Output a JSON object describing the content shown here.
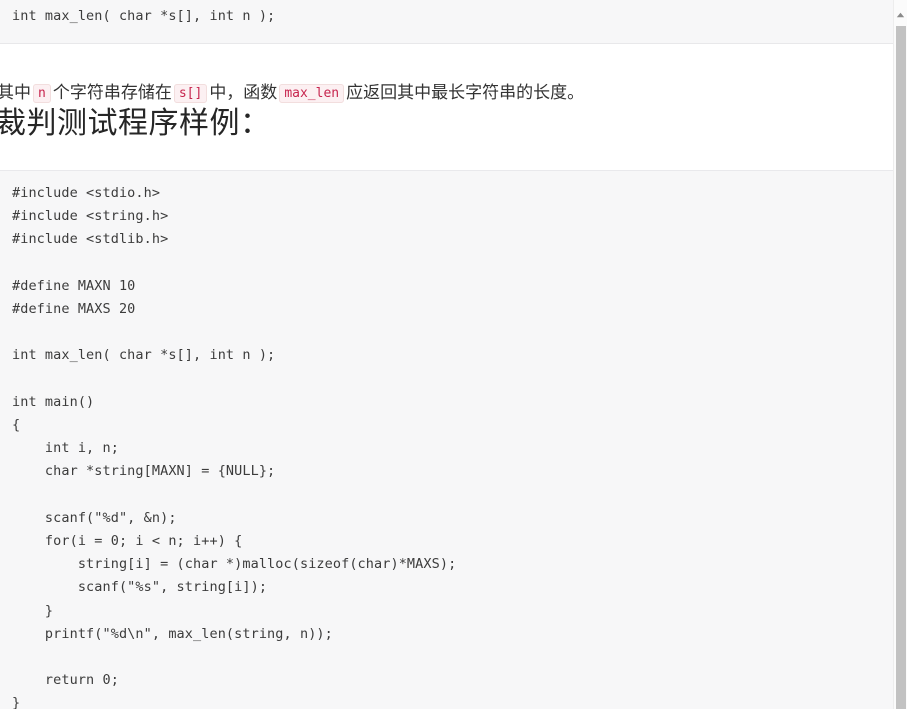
{
  "document": {
    "top_code_snippet": "int max_len( char *s[], int n );",
    "paragraph": {
      "segment_1": "其中",
      "code_1": "n",
      "segment_2": "个字符串存储在",
      "code_2": "s[]",
      "segment_3": "中，函数",
      "code_3": "max_len",
      "segment_4": "应返回其中最长字符串的长度。"
    },
    "heading": "裁判测试程序样例：",
    "main_code": "#include <stdio.h>\n#include <string.h>\n#include <stdlib.h>\n\n#define MAXN 10\n#define MAXS 20\n\nint max_len( char *s[], int n );\n\nint main()\n{\n    int i, n;\n    char *string[MAXN] = {NULL};\n\n    scanf(\"%d\", &n);\n    for(i = 0; i < n; i++) {\n        string[i] = (char *)malloc(sizeof(char)*MAXS);\n        scanf(\"%s\", string[i]);\n    }\n    printf(\"%d\\n\", max_len(string, n));\n\n    return 0;\n}"
  },
  "scrollbar": {
    "up_arrow_icon": "chevron-up-icon",
    "thumb_label": "vertical-scroll-thumb"
  },
  "colors": {
    "page_background": "#ffffff",
    "code_background": "#f7f7f8",
    "code_text": "#3c3c3c",
    "inline_code_text": "#c7254e",
    "inline_code_background": "#fcf0f2",
    "body_text": "#333333",
    "heading_text": "#262626",
    "scrollbar_thumb": "#c2c2c2"
  }
}
